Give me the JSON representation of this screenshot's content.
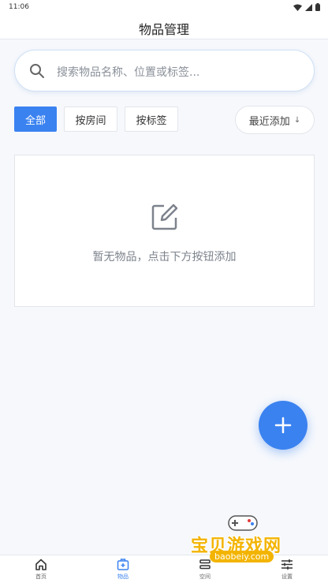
{
  "status_bar": {
    "time": "11:06"
  },
  "header": {
    "title": "物品管理"
  },
  "search": {
    "placeholder": "搜索物品名称、位置或标签..."
  },
  "filters": {
    "tabs": [
      {
        "label": "全部",
        "active": true
      },
      {
        "label": "按房间",
        "active": false
      },
      {
        "label": "按标签",
        "active": false
      }
    ],
    "sort_label": "最近添加",
    "sort_arrow": "↓"
  },
  "empty_state": {
    "message": "暂无物品，点击下方按钮添加"
  },
  "bottom_nav": {
    "items": [
      {
        "label": "首页",
        "icon": "home-icon",
        "active": false
      },
      {
        "label": "物品",
        "icon": "box-icon",
        "active": true
      },
      {
        "label": "空间",
        "icon": "layers-icon",
        "active": false
      },
      {
        "label": "设置",
        "icon": "sliders-icon",
        "active": false
      }
    ]
  },
  "watermark": {
    "title": "宝贝游戏网",
    "url": "baobeiy.com"
  },
  "colors": {
    "accent": "#3a82f0",
    "background": "#f6f8fc",
    "watermark": "#f3b400"
  }
}
